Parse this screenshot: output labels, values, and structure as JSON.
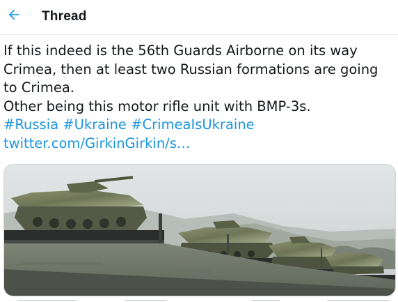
{
  "header": {
    "title": "Thread",
    "back_icon": "arrow-left-icon",
    "accent_color": "#1da1f2"
  },
  "tweet": {
    "text_lines": [
      "If this indeed is the 56th Guards Airborne on its way",
      "Crimea, then at least two Russian formations are going",
      "to Crimea.",
      "Other being this motor rifle unit with BMP-3s."
    ],
    "hashtags": [
      "#Russia",
      "#Ukraine",
      "#CrimeaIsUkraine"
    ],
    "link": "twitter.com/GirkinGirkin/s…",
    "link_color": "#1b95e0"
  },
  "media": {
    "type": "video-still",
    "subject": "military vehicles on railway flatcars"
  }
}
